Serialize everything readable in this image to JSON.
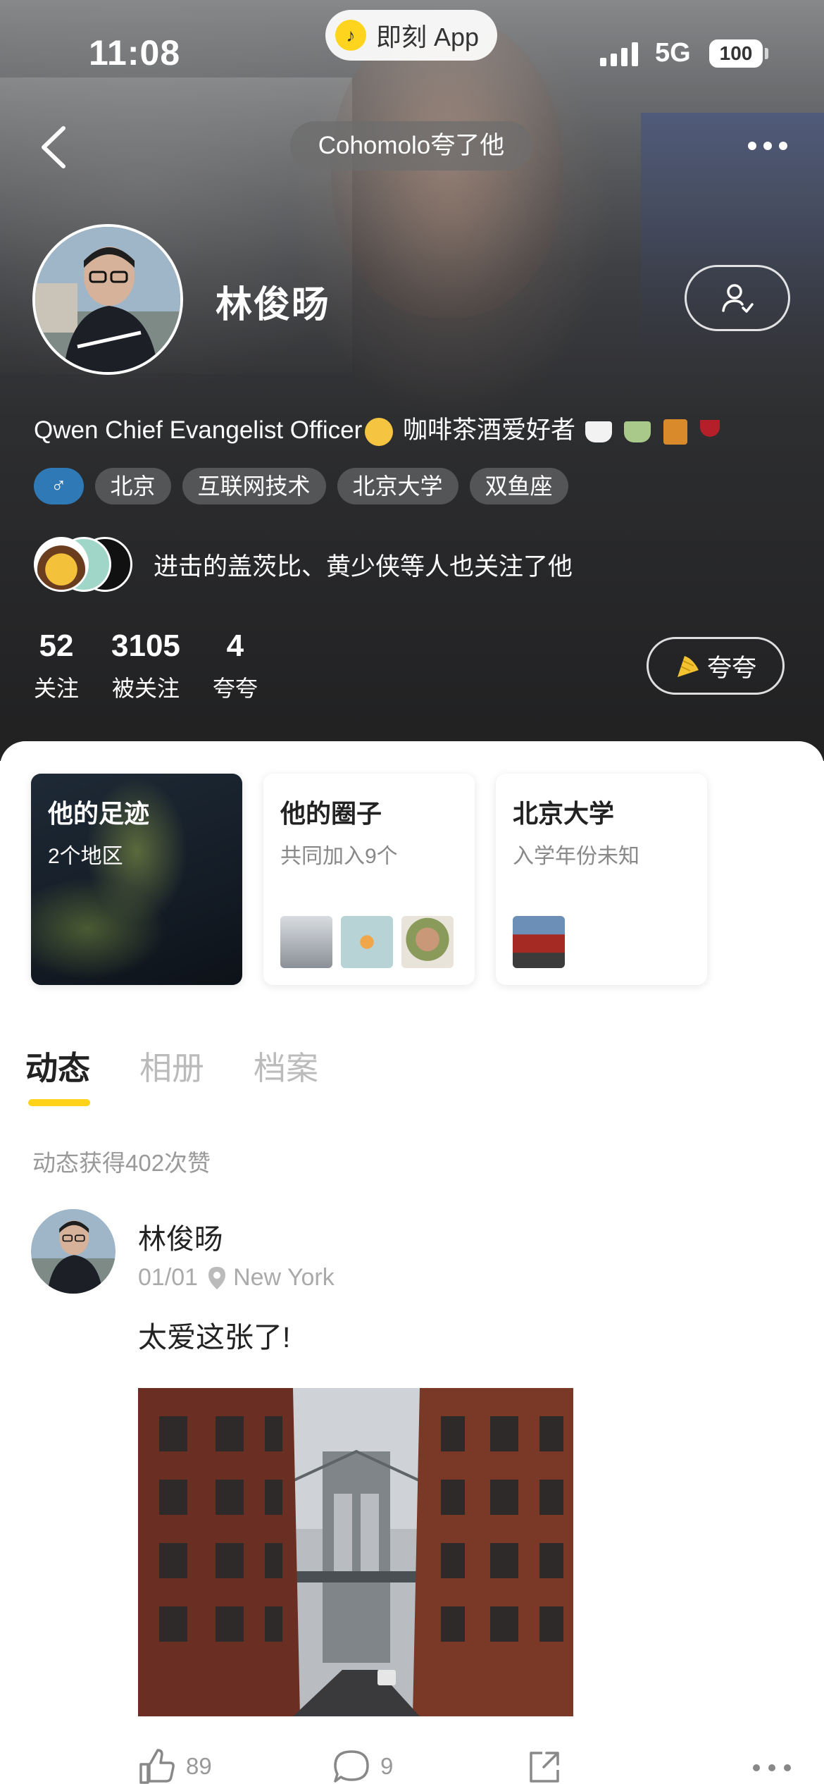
{
  "status_bar": {
    "time": "11:08",
    "app_pill": "即刻 App",
    "network": "5G",
    "battery": "100"
  },
  "nav": {
    "praise_banner": "Cohomolo夸了他"
  },
  "profile": {
    "name": "林俊旸",
    "bio": "Qwen Chief Evangelist Officer",
    "bio_suffix": "咖啡茶酒爱好者",
    "tags": [
      "北京",
      "互联网技术",
      "北京大学",
      "双鱼座"
    ],
    "gender_symbol": "♂",
    "mutual_text": "进击的盖茨比、黄少侠等人也关注了他",
    "stats": [
      {
        "num": "52",
        "label": "关注"
      },
      {
        "num": "3105",
        "label": "被关注"
      },
      {
        "num": "4",
        "label": "夸夸"
      }
    ],
    "praise_button": "夸夸"
  },
  "cards": [
    {
      "title": "他的足迹",
      "subtitle": "2个地区"
    },
    {
      "title": "他的圈子",
      "subtitle": "共同加入9个"
    },
    {
      "title": "北京大学",
      "subtitle": "入学年份未知"
    }
  ],
  "tabs": [
    "动态",
    "相册",
    "档案"
  ],
  "feed": {
    "likes_summary": "动态获得402次赞",
    "post": {
      "author": "林俊旸",
      "date": "01/01",
      "location": "New York",
      "text": "太爱这张了!",
      "like_count": "89",
      "comment_count": "9"
    }
  },
  "colors": {
    "accent": "#ffd21a",
    "gender_badge": "#2f79b6"
  }
}
